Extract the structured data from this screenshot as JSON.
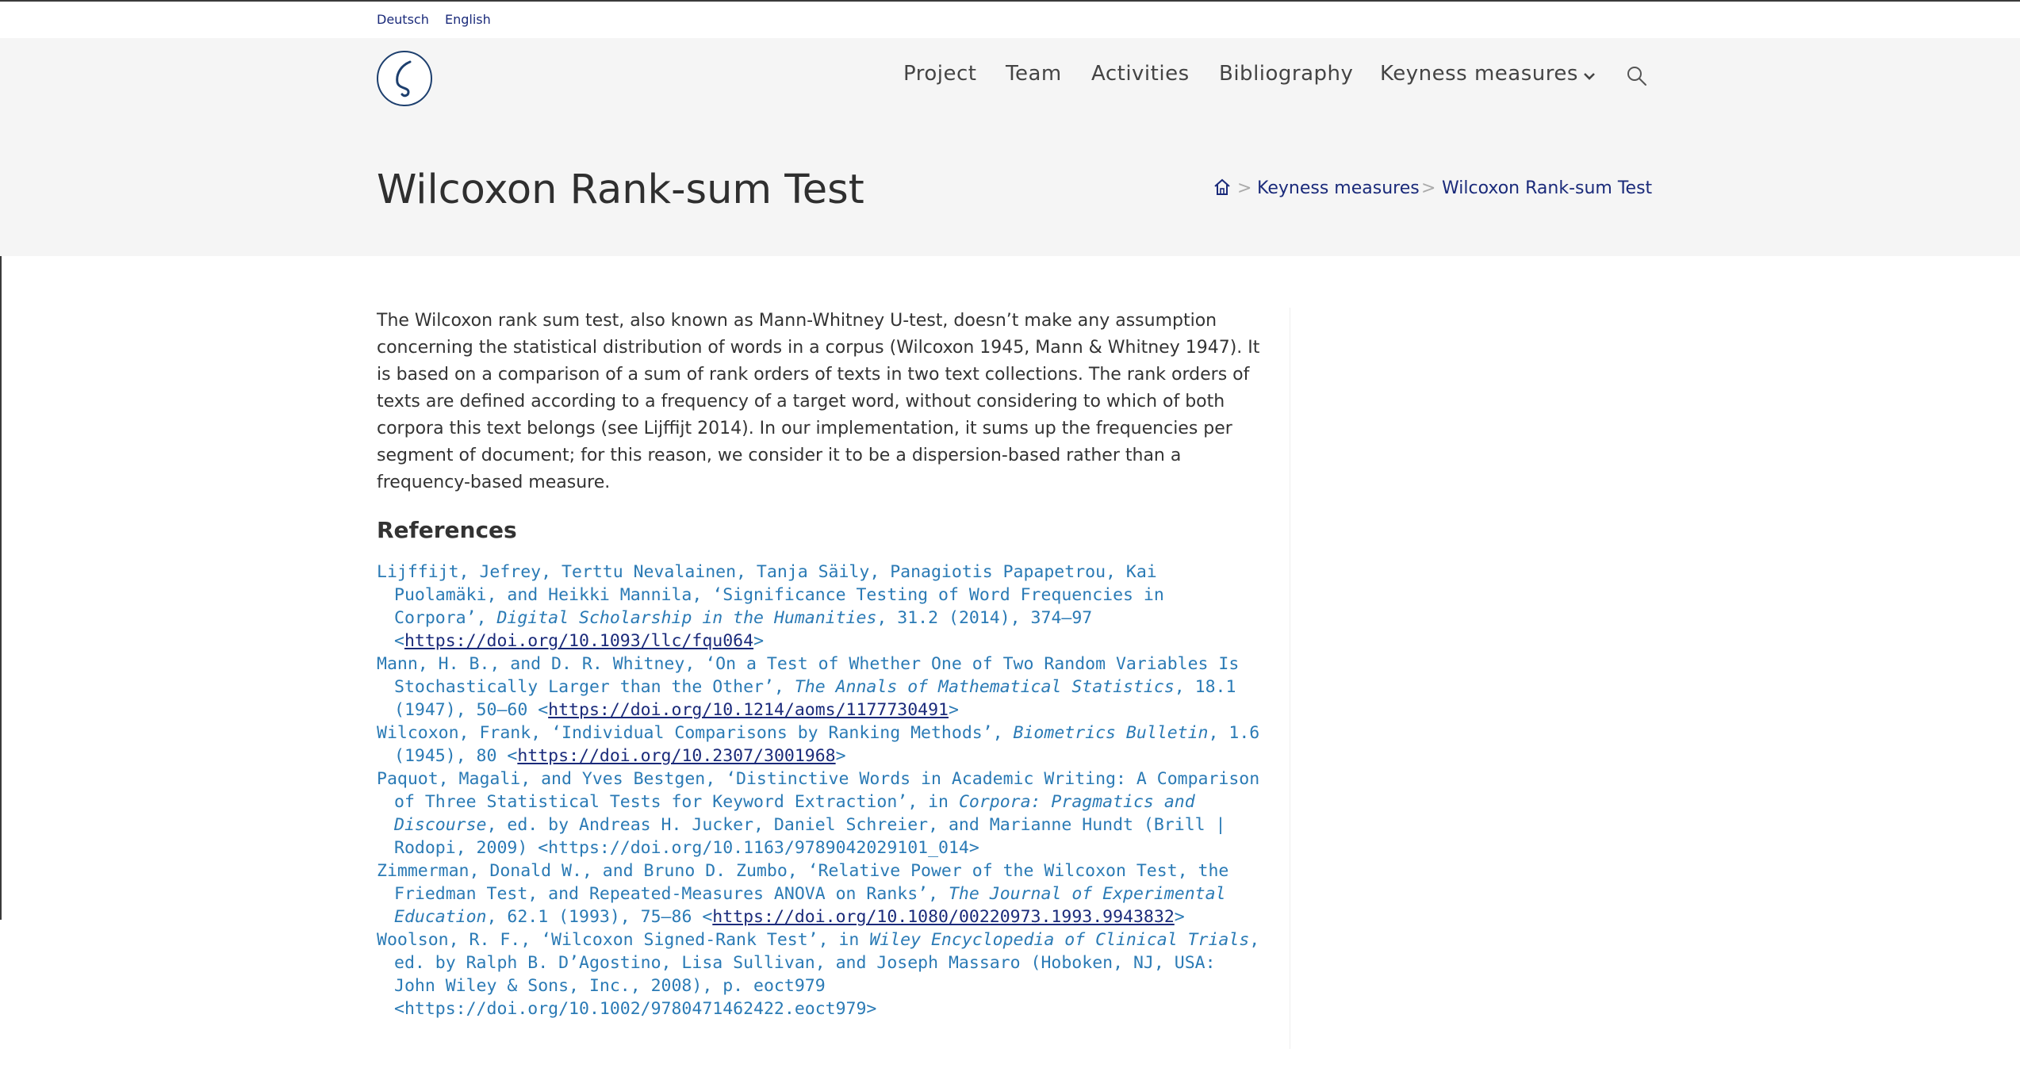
{
  "language_bar": {
    "items": [
      "Deutsch",
      "English"
    ]
  },
  "nav": {
    "items": [
      "Project",
      "Team",
      "Activities",
      "Bibliography",
      "Keyness measures"
    ]
  },
  "page": {
    "title": "Wilcoxon Rank-sum Test"
  },
  "breadcrumb": {
    "separator": ">",
    "items": [
      "Keyness measures",
      "Wilcoxon Rank-sum Test"
    ]
  },
  "article": {
    "intro": "The Wilcoxon rank sum test, also known as Mann-Whitney U-test, doesn’t make any assumption concerning the statistical distribution of words in a corpus (Wilcoxon 1945, Mann & Whitney 1947). It is based on a comparison of a sum of rank orders of texts in two text collections. The rank orders of texts are defined according to a frequency of a target word, without considering to which of both corpora this text belongs (see Lijffijt 2014). In our implementation, it sums up the frequencies per segment of document; for this reason, we consider it to be a dispersion-based rather than a frequency-based measure.",
    "references_heading": "References",
    "references": [
      {
        "pre": "Lijffijt, Jefrey, Terttu Nevalainen, Tanja Säily, Panagiotis Papapetrou, Kai Puolamäki, and Heikki Mannila, ‘Significance Testing of Word Frequencies in Corpora’, ",
        "journal": "Digital Scholarship in the Humanities",
        "post": ", 31.2 (2014), 374–97 <",
        "link": "https://doi.org/10.1093/llc/fqu064",
        "tail": ">"
      },
      {
        "pre": "Mann, H. B., and D. R. Whitney, ‘On a Test of Whether One of Two Random Variables Is Stochastically Larger than the Other’, ",
        "journal": "The Annals of Mathematical Statistics",
        "post": ", 18.1 (1947), 50–60 <",
        "link": "https://doi.org/10.1214/aoms/1177730491",
        "tail": ">"
      },
      {
        "pre": "Wilcoxon, Frank, ‘Individual Comparisons by Ranking Methods’, ",
        "journal": "Biometrics Bulletin",
        "post": ", 1.6 (1945), 80 <",
        "link": "https://doi.org/10.2307/3001968",
        "tail": ">"
      },
      {
        "pre": "Paquot, Magali, and Yves Bestgen, ‘Distinctive Words in Academic Writing: A Comparison of Three Statistical Tests for Keyword Extraction’, in ",
        "journal": "Corpora: Pragmatics and Discourse",
        "post": ", ed. by Andreas H. Jucker, Daniel Schreier, and Marianne Hundt (Brill | Rodopi, 2009) <https://doi.org/10.1163/9789042029101_014>",
        "link": "",
        "tail": ""
      },
      {
        "pre": "Zimmerman, Donald W., and Bruno D. Zumbo, ‘Relative Power of the Wilcoxon Test, the Friedman Test, and Repeated-Measures ANOVA on Ranks’, ",
        "journal": "The Journal of Experimental Education",
        "post": ", 62.1 (1993), 75–86 <",
        "link": "https://doi.org/10.1080/00220973.1993.9943832",
        "tail": ">"
      },
      {
        "pre": "Woolson, R. F., ‘Wilcoxon Signed-Rank Test’, in ",
        "journal": "Wiley Encyclopedia of Clinical Trials",
        "post": ", ed. by Ralph B. D’Agostino, Lisa Sullivan, and Joseph Massaro (Hoboken, NJ, USA: John Wiley & Sons, Inc., 2008), p. eoct979 <https://doi.org/10.1002/9780471462422.eoct979>",
        "link": "",
        "tail": ""
      }
    ]
  },
  "colors": {
    "link_dark": "#1a2a7a",
    "reference_text": "#2a7ab5",
    "header_bg": "#f5f5f5",
    "logo_blue": "#1d3f6e"
  },
  "icons": {
    "logo": "zeta-logo-icon",
    "nav_dropdown": "chevron-down-icon",
    "search": "search-icon",
    "home": "home-icon"
  }
}
